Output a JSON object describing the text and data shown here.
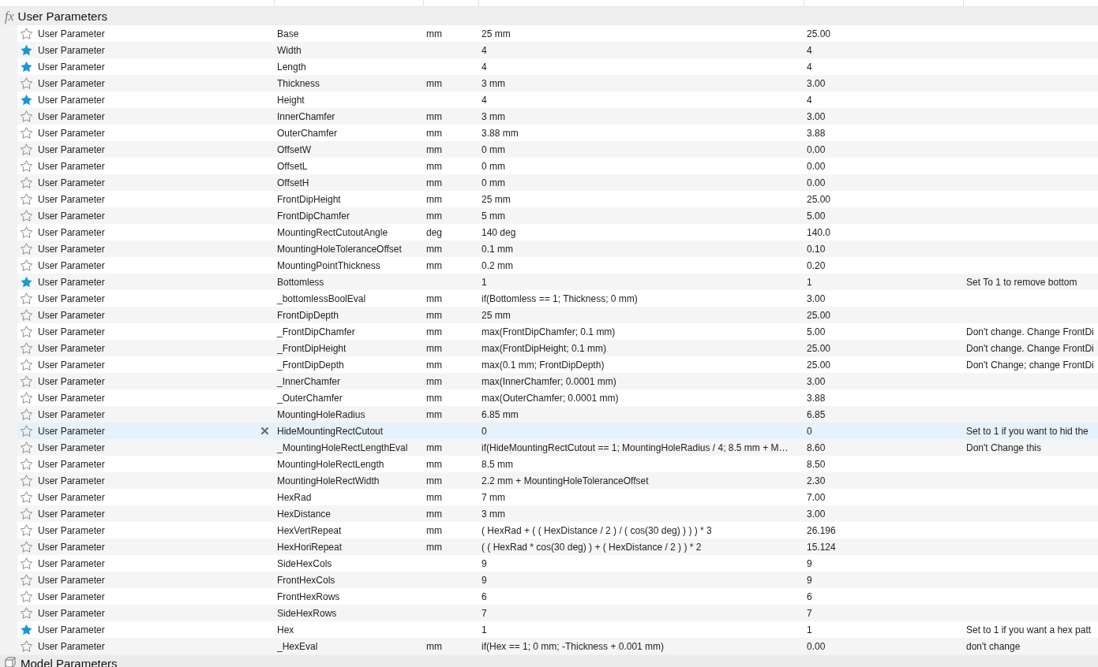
{
  "user_parameters": {
    "icon": "fx",
    "title": "User Parameters",
    "rows": [
      {
        "favorite": false,
        "selected": false,
        "type": "User Parameter",
        "name": "Base",
        "unit": "mm",
        "expression": "25 mm",
        "value": "25.00"
      },
      {
        "favorite": true,
        "selected": false,
        "type": "User Parameter",
        "name": "Width",
        "expression": "4",
        "value": "4"
      },
      {
        "favorite": true,
        "selected": false,
        "type": "User Parameter",
        "name": "Length",
        "expression": "4",
        "value": "4"
      },
      {
        "favorite": false,
        "selected": false,
        "type": "User Parameter",
        "name": "Thickness",
        "unit": "mm",
        "expression": "3 mm",
        "value": "3.00"
      },
      {
        "favorite": true,
        "selected": false,
        "type": "User Parameter",
        "name": "Height",
        "expression": "4",
        "value": "4"
      },
      {
        "favorite": false,
        "selected": false,
        "type": "User Parameter",
        "name": "InnerChamfer",
        "unit": "mm",
        "expression": "3 mm",
        "value": "3.00"
      },
      {
        "favorite": false,
        "selected": false,
        "type": "User Parameter",
        "name": "OuterChamfer",
        "unit": "mm",
        "expression": "3.88 mm",
        "value": "3.88"
      },
      {
        "favorite": false,
        "selected": false,
        "type": "User Parameter",
        "name": "OffsetW",
        "unit": "mm",
        "expression": "0 mm",
        "value": "0.00"
      },
      {
        "favorite": false,
        "selected": false,
        "type": "User Parameter",
        "name": "OffsetL",
        "unit": "mm",
        "expression": "0 mm",
        "value": "0.00"
      },
      {
        "favorite": false,
        "selected": false,
        "type": "User Parameter",
        "name": "OffsetH",
        "unit": "mm",
        "expression": "0 mm",
        "value": "0.00"
      },
      {
        "favorite": false,
        "selected": false,
        "type": "User Parameter",
        "name": "FrontDipHeight",
        "unit": "mm",
        "expression": "25 mm",
        "value": "25.00"
      },
      {
        "favorite": false,
        "selected": false,
        "type": "User Parameter",
        "name": "FrontDipChamfer",
        "unit": "mm",
        "expression": "5 mm",
        "value": "5.00"
      },
      {
        "favorite": false,
        "selected": false,
        "type": "User Parameter",
        "name": "MountingRectCutoutAngle",
        "unit": "deg",
        "expression": "140 deg",
        "value": "140.0"
      },
      {
        "favorite": false,
        "selected": false,
        "type": "User Parameter",
        "name": "MountingHoleToleranceOffset",
        "unit": "mm",
        "expression": "0.1 mm",
        "value": "0.10"
      },
      {
        "favorite": false,
        "selected": false,
        "type": "User Parameter",
        "name": "MountingPointThickness",
        "unit": "mm",
        "expression": "0.2 mm",
        "value": "0.20"
      },
      {
        "favorite": true,
        "selected": false,
        "type": "User Parameter",
        "name": "Bottomless",
        "expression": "1",
        "value": "1",
        "comment": "Set To 1 to remove bottom"
      },
      {
        "favorite": false,
        "selected": false,
        "type": "User Parameter",
        "name": "_bottomlessBoolEval",
        "unit": "mm",
        "expression": "if(Bottomless == 1; Thickness; 0 mm)",
        "value": "3.00"
      },
      {
        "favorite": false,
        "selected": false,
        "type": "User Parameter",
        "name": "FrontDipDepth",
        "unit": "mm",
        "expression": "25 mm",
        "value": "25.00"
      },
      {
        "favorite": false,
        "selected": false,
        "type": "User Parameter",
        "name": "_FrontDipChamfer",
        "unit": "mm",
        "expression": "max(FrontDipChamfer; 0.1 mm)",
        "value": "5.00",
        "comment": "Don't change. Change FrontDi"
      },
      {
        "favorite": false,
        "selected": false,
        "type": "User Parameter",
        "name": "_FrontDipHeight",
        "unit": "mm",
        "expression": "max(FrontDipHeight; 0.1 mm)",
        "value": "25.00",
        "comment": "Don't change. Change FrontDi"
      },
      {
        "favorite": false,
        "selected": false,
        "type": "User Parameter",
        "name": "_FrontDipDepth",
        "unit": "mm",
        "expression": "max(0.1 mm; FrontDipDepth)",
        "value": "25.00",
        "comment": "Don't Change; change FrontDi"
      },
      {
        "favorite": false,
        "selected": false,
        "type": "User Parameter",
        "name": "_InnerChamfer",
        "unit": "mm",
        "expression": "max(InnerChamfer; 0.0001 mm)",
        "value": "3.00"
      },
      {
        "favorite": false,
        "selected": false,
        "type": "User Parameter",
        "name": "_OuterChamfer",
        "unit": "mm",
        "expression": "max(OuterChamfer; 0.0001 mm)",
        "value": "3.88"
      },
      {
        "favorite": false,
        "selected": false,
        "type": "User Parameter",
        "name": "MountingHoleRadius",
        "unit": "mm",
        "expression": "6.85 mm",
        "value": "6.85"
      },
      {
        "favorite": false,
        "selected": true,
        "type": "User Parameter",
        "name": "HideMountingRectCutout",
        "expression": "0",
        "value": "0",
        "comment": "Set to 1 if you want to hid the"
      },
      {
        "favorite": false,
        "selected": false,
        "type": "User Parameter",
        "name": "_MountingHoleRectLengthEval",
        "unit": "mm",
        "expression": "if(HideMountingRectCutout == 1; MountingHoleRadius / 4; 8.5 mm + M…",
        "value": "8.60",
        "comment": "Don't Change this"
      },
      {
        "favorite": false,
        "selected": false,
        "type": "User Parameter",
        "name": "MountingHoleRectLength",
        "unit": "mm",
        "expression": "8.5 mm",
        "value": "8.50"
      },
      {
        "favorite": false,
        "selected": false,
        "type": "User Parameter",
        "name": "MountingHoleRectWidth",
        "unit": "mm",
        "expression": "2.2 mm + MountingHoleToleranceOffset",
        "value": "2.30"
      },
      {
        "favorite": false,
        "selected": false,
        "type": "User Parameter",
        "name": "HexRad",
        "unit": "mm",
        "expression": "7 mm",
        "value": "7.00"
      },
      {
        "favorite": false,
        "selected": false,
        "type": "User Parameter",
        "name": "HexDistance",
        "unit": "mm",
        "expression": "3 mm",
        "value": "3.00"
      },
      {
        "favorite": false,
        "selected": false,
        "type": "User Parameter",
        "name": "HexVertRepeat",
        "unit": "mm",
        "expression": "( HexRad + ( ( HexDistance / 2 ) / ( cos(30 deg) ) ) ) * 3",
        "value": "26.196"
      },
      {
        "favorite": false,
        "selected": false,
        "type": "User Parameter",
        "name": "HexHoriRepeat",
        "unit": "mm",
        "expression": "( ( HexRad * cos(30 deg) ) + ( HexDistance / 2 ) ) * 2",
        "value": "15.124"
      },
      {
        "favorite": false,
        "selected": false,
        "type": "User Parameter",
        "name": "SideHexCols",
        "expression": "9",
        "value": "9"
      },
      {
        "favorite": false,
        "selected": false,
        "type": "User Parameter",
        "name": "FrontHexCols",
        "expression": "9",
        "value": "9"
      },
      {
        "favorite": false,
        "selected": false,
        "type": "User Parameter",
        "name": "FrontHexRows",
        "expression": "6",
        "value": "6"
      },
      {
        "favorite": false,
        "selected": false,
        "type": "User Parameter",
        "name": "SideHexRows",
        "expression": "7",
        "value": "7"
      },
      {
        "favorite": true,
        "selected": false,
        "type": "User Parameter",
        "name": "Hex",
        "expression": "1",
        "value": "1",
        "comment": "Set to 1 if you want a hex patt"
      },
      {
        "favorite": false,
        "selected": false,
        "type": "User Parameter",
        "name": "_HexEval",
        "unit": "mm",
        "expression": "if(Hex == 1; 0 mm; -Thickness + 0.001 mm)",
        "value": "0.00",
        "comment": "don't change"
      }
    ]
  },
  "model_parameters": {
    "title": "Model Parameters"
  }
}
